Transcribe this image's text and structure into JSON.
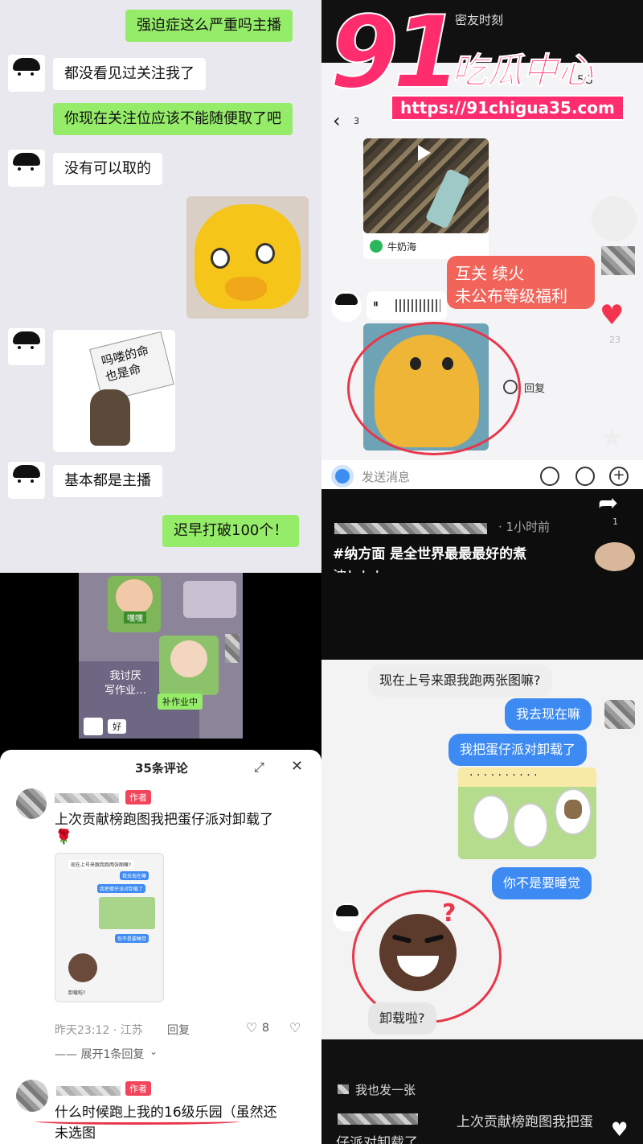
{
  "watermark": {
    "number": "91",
    "brand": "吃瓜中心",
    "url": "https://91chigua35.com"
  },
  "panel_top_left": {
    "messages": [
      {
        "side": "right",
        "text": "强迫症这么严重吗主播"
      },
      {
        "side": "left",
        "text": "都没看见过关注我了"
      },
      {
        "side": "right",
        "text": "你现在关注位应该不能随便取了吧"
      },
      {
        "side": "left",
        "text": "没有可以取的"
      },
      {
        "side": "left",
        "text": "基本都是主播"
      },
      {
        "side": "right",
        "text": "迟早打破100个！"
      }
    ],
    "sticker_text": "吗喽的命\n也是命"
  },
  "panel_top_right": {
    "top_title": "密友时刻",
    "status": "5G",
    "badge_count": "3",
    "location_tag": "牛奶海",
    "red_bubble_line1": "互关 续火",
    "red_bubble_line2": "未公布等级福利",
    "reply_label": "回复",
    "input_placeholder": "发送消息",
    "likes": "23",
    "shares": "1"
  },
  "panel_mid_right": {
    "time_ago": "· 1小时前",
    "caption_line1": "#纳方面 是全世界最最最好的煮",
    "caption_line2": "波！！！"
  },
  "panel_mid_left": {
    "label1": "嘿嘿",
    "label2": "我讨厌\n写作业…",
    "label3": "补作业中",
    "label4": "好"
  },
  "panel_bottom_left": {
    "comments_title": "35条评论",
    "author_tag": "作者",
    "comment1": "上次贡献榜跑图我把蛋仔派对卸载了",
    "comment1_time": "昨天23:12 · 江苏",
    "reply_label": "回复",
    "like_count": "8",
    "expand_replies": "—— 展开1条回复",
    "comment2_line1": "什么时候跑上我的16级乐园（虽然还",
    "comment2_line2": "未选图",
    "thumb_lines": [
      "现在上号来跟我跑两张图嘛?",
      "我去现在嘛",
      "我把蛋仔派对卸载了",
      "你不是要睡觉",
      "卸载啦?"
    ]
  },
  "panel_bottom_right": {
    "messages": [
      {
        "side": "left",
        "text": "现在上号来跟我跑两张图嘛?"
      },
      {
        "side": "right",
        "text": "我去现在嘛"
      },
      {
        "side": "right",
        "text": "我把蛋仔派对卸载了"
      },
      {
        "side": "right",
        "text": "你不是要睡觉"
      },
      {
        "side": "left",
        "text": "卸载啦?"
      }
    ],
    "footer_line1": "我也发一张",
    "footer_line2": "上次贡献榜跑图我把蛋",
    "footer_line3": "仔派对卸载了"
  },
  "colors": {
    "wechat_green": "#95ec69",
    "chat_bg": "#ededed",
    "blue_bubble": "#3d8bf2",
    "red_accent": "#e8364a",
    "watermark_pink": "#ff2d6e"
  }
}
